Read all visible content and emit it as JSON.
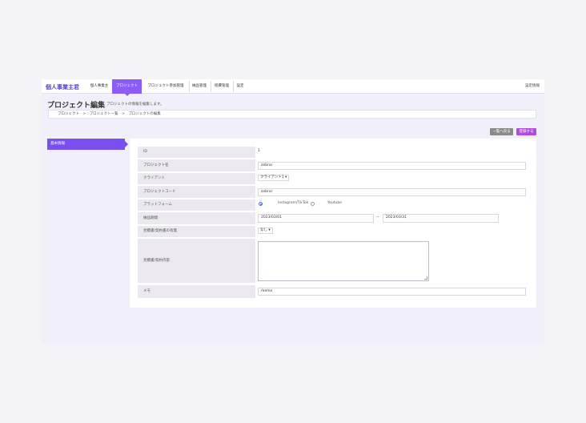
{
  "navbar": {
    "brand": "個人事業主君",
    "items": [
      {
        "label": "個人事業主"
      },
      {
        "label": "プロジェクト"
      },
      {
        "label": "プロジェクト参加管理"
      },
      {
        "label": "納品管理"
      },
      {
        "label": "経費管理"
      },
      {
        "label": "設定"
      }
    ],
    "active_index": 1,
    "right_label": "設定情報"
  },
  "header": {
    "title": "プロジェクト編集",
    "subtitle": "プロジェクトの情報を編集します。"
  },
  "breadcrumb": {
    "items": [
      "プロジェクト",
      "プロジェクト一覧",
      "プロジェクトの編集"
    ],
    "separator": ">"
  },
  "actions": {
    "back_label": "一覧へ戻る",
    "submit_label": "登録する"
  },
  "sidebar": {
    "tab_label": "基本情報"
  },
  "form": {
    "id_label": "ID",
    "id_value": "1",
    "name_label": "プロジェクト名",
    "name_value": "zebrar",
    "client_label": "クライアント",
    "client_value": "クライアント1 ▾",
    "code_label": "プロジェクトコード",
    "code_value": "zebrar",
    "platform_label": "プラットフォーム",
    "platform_options": [
      {
        "label": "",
        "selected": true
      },
      {
        "label": "Instagram/TikTok",
        "selected": false
      },
      {
        "label": "Youtube",
        "selected": false
      }
    ],
    "period_label": "納品期間",
    "period_start": "2023/03/01",
    "period_end": "2023/03/31",
    "period_separator": "~",
    "amount_label": "見積書/契約書の有無",
    "amount_value": "なし ▾",
    "contract_label": "見積書/契約内容",
    "contract_value": "",
    "memo_label": "メモ",
    "memo_value": "memo"
  }
}
